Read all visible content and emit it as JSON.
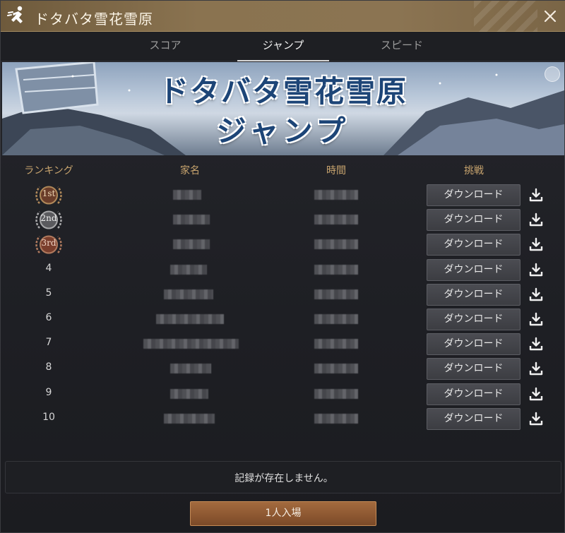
{
  "window": {
    "title": "ドタバタ雪花雪原",
    "icon": "running-figure-icon",
    "close_icon": "close-icon"
  },
  "tabs": [
    {
      "label": "スコア",
      "active": false
    },
    {
      "label": "ジャンプ",
      "active": true
    },
    {
      "label": "スピード",
      "active": false
    }
  ],
  "banner": {
    "line1": "ドタバタ雪花雪原",
    "line2": "ジャンプ"
  },
  "table": {
    "headers": [
      "ランキング",
      "家名",
      "時間",
      "挑戦"
    ],
    "rows": [
      {
        "rank": "1st",
        "medal": "gold"
      },
      {
        "rank": "2nd",
        "medal": "silver"
      },
      {
        "rank": "3rd",
        "medal": "bronze"
      },
      {
        "rank": "4"
      },
      {
        "rank": "5"
      },
      {
        "rank": "6"
      },
      {
        "rank": "7"
      },
      {
        "rank": "8"
      },
      {
        "rank": "9"
      },
      {
        "rank": "10"
      }
    ],
    "download_label": "ダウンロード",
    "download_icon": "download-icon"
  },
  "record_message": "記録が存在しません。",
  "enter_button": "1人入場",
  "colors": {
    "accent_gold": "#c8a46e",
    "title_bar": "#8a7350",
    "enter_button": "#8c5731"
  }
}
